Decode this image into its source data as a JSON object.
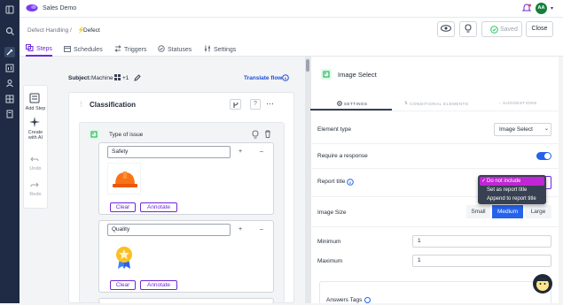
{
  "app": {
    "name": "Sales Demo",
    "user_initials": "AA"
  },
  "breadcrumb": {
    "parent": "Defect Handling /",
    "current": "Defect"
  },
  "header": {
    "saved_label": "Saved",
    "close_label": "Close"
  },
  "tabs": [
    {
      "label": "Steps",
      "active": true
    },
    {
      "label": "Schedules"
    },
    {
      "label": "Triggers"
    },
    {
      "label": "Statuses"
    },
    {
      "label": "Settings"
    }
  ],
  "toolbox": {
    "add_step": "Add Step",
    "create_ai_1": "Create",
    "create_ai_2": "with AI",
    "undo": "Undo",
    "redo": "Redo"
  },
  "canvas": {
    "subject_label": "Subject:",
    "subject_value": "Machine",
    "subject_extra": "+1",
    "translate_flow": "Translate flow",
    "step_title": "Classification",
    "question_title": "Type of issue",
    "options": [
      {
        "label": "Safety",
        "clear": "Clear",
        "annotate": "Annotate"
      },
      {
        "label": "Quality",
        "clear": "Clear",
        "annotate": "Annotate"
      }
    ]
  },
  "panel": {
    "title": "Image Select",
    "tabs": [
      "SETTINGS",
      "CONDITIONAL ELEMENTS",
      "SUGGESTIONS"
    ],
    "element_type_label": "Element type",
    "element_type_value": "Image Select",
    "require_response_label": "Require a response",
    "require_response_on": true,
    "report_title_label": "Report title",
    "report_title_options": [
      "Do not include",
      "Set as report title",
      "Append to report title"
    ],
    "report_title_selected": "Do not include",
    "image_size_label": "Image Size",
    "image_sizes": [
      "Small",
      "Medium",
      "Large"
    ],
    "image_size_selected": "Medium",
    "minimum_label": "Minimum",
    "minimum_value": "1",
    "maximum_label": "Maximum",
    "maximum_value": "1",
    "answers_tags_label": "Answers Tags"
  },
  "colors": {
    "accent": "#6d28d9",
    "rail": "#1f2a44",
    "toggle": "#2563eb",
    "menu_highlight": "#c026d3",
    "selected_size": "#2563eb"
  }
}
